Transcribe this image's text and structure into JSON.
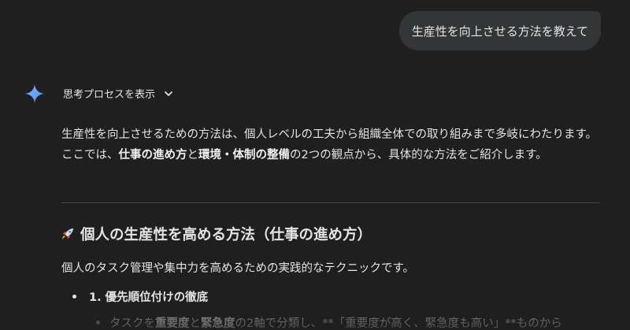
{
  "user_message": "生産性を向上させる方法を教えて",
  "thought_toggle": {
    "label": "思考プロセスを表示",
    "icon": "chevron-down-icon"
  },
  "assistant_icon": "gemini-sparkle-icon",
  "response": {
    "intro": {
      "part1": "生産性を向上させるための方法は、個人レベルの工夫から組織全体での取り組みまで多岐にわたります。ここでは、",
      "bold1": "仕事の進め方",
      "part2": "と",
      "bold2": "環境・体制の整備",
      "part3": "の2つの観点から、具体的な方法をご紹介します。"
    },
    "section1": {
      "emoji_icon": "rocket-icon",
      "title": "個人の生産性を高める方法（仕事の進め方）",
      "description": "個人のタスク管理や集中力を高めるための実践的なテクニックです。",
      "item1_label": "1. 優先順位付けの徹底",
      "sub1": {
        "part1": "タスクを",
        "bold1": "重要度",
        "part2": "と",
        "bold2": "緊急度",
        "part3": "の2軸で分類し、**「重要度が高く、緊急度も高い」**ものから"
      }
    }
  },
  "colors": {
    "background": "#1f1f1f",
    "bubble": "#333537",
    "text": "#e3e3e3",
    "divider": "#444746",
    "gem_blue": "#4a90f2"
  }
}
